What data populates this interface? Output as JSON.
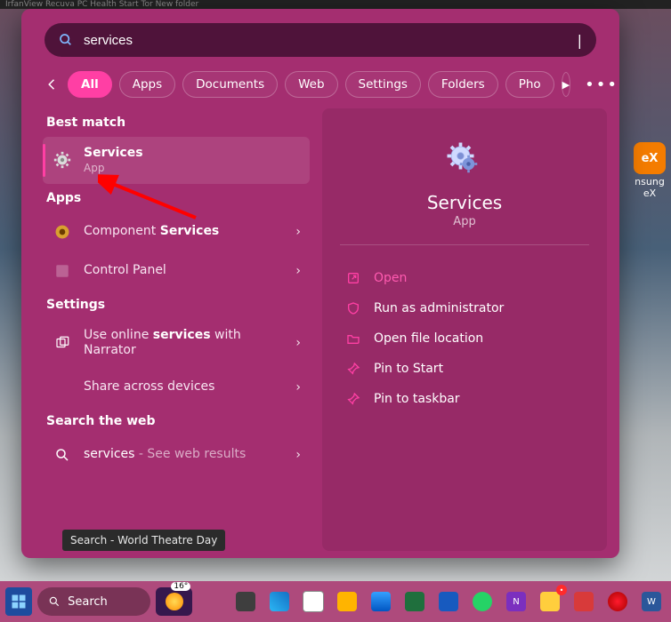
{
  "strip": "IrfanView   Recuva   PC Health   Start Tor   New folder",
  "search": {
    "value": "services"
  },
  "tabs": {
    "all": "All",
    "apps": "Apps",
    "documents": "Documents",
    "web": "Web",
    "settings": "Settings",
    "folders": "Folders",
    "photos": "Pho"
  },
  "sections": {
    "best": "Best match",
    "apps": "Apps",
    "settings": "Settings",
    "web": "Search the web"
  },
  "bestMatch": {
    "title": "Services",
    "type": "App"
  },
  "appsList": {
    "component_prefix": "Component ",
    "component_bold": "Services",
    "control_panel": "Control Panel"
  },
  "settingsList": {
    "narrator_prefix": "Use online ",
    "narrator_bold": "services",
    "narrator_suffix": " with Narrator",
    "share": "Share across devices"
  },
  "webList": {
    "prefix": "services",
    "suffix": " - See web results"
  },
  "preview": {
    "title": "Services",
    "sub": "App",
    "open": "Open",
    "admin": "Run as administrator",
    "loc": "Open file location",
    "pinstart": "Pin to Start",
    "pintask": "Pin to taskbar"
  },
  "tooltip": "Search - World Theatre Day",
  "taskbar": {
    "search": "Search",
    "temp": "16°"
  },
  "dex": {
    "label": "eX",
    "sub1": "nsung",
    "sub2": "eX"
  }
}
